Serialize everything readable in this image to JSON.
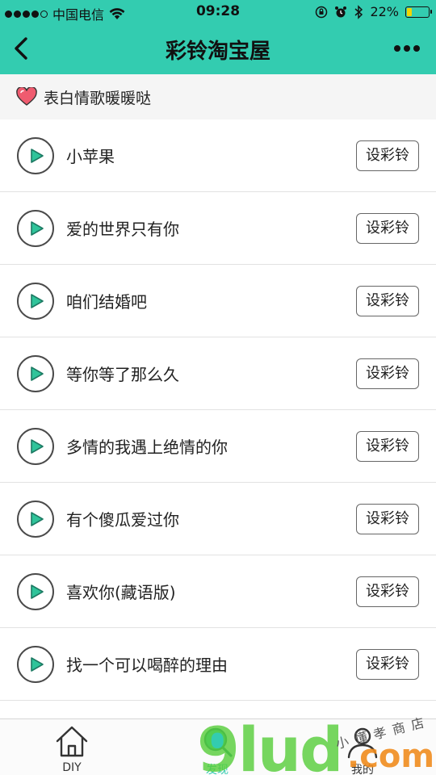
{
  "status_bar": {
    "carrier": "中国电信",
    "time": "09:28",
    "battery": "22%",
    "battery_level": 0.22
  },
  "header": {
    "title": "彩铃淘宝屋",
    "back_icon": "chevron-left-icon",
    "more_icon": "more-dots-icon"
  },
  "category": {
    "label": "表白情歌暖暖哒",
    "icon": "heart-icon",
    "icon_color": "#ef5b6f"
  },
  "set_button_label": "设彩铃",
  "songs": [
    {
      "title": "小苹果"
    },
    {
      "title": "爱的世界只有你"
    },
    {
      "title": "咱们结婚吧"
    },
    {
      "title": "等你等了那么久"
    },
    {
      "title": "多情的我遇上绝情的你"
    },
    {
      "title": "有个傻瓜爱过你"
    },
    {
      "title": "喜欢你(藏语版)"
    },
    {
      "title": "找一个可以喝醉的理由"
    },
    {
      "title": ""
    }
  ],
  "tabbar": {
    "items": [
      {
        "label": "DIY",
        "icon": "home-icon"
      },
      {
        "label": "发现",
        "icon": "discover-icon",
        "active": true
      },
      {
        "label": "我的",
        "icon": "user-icon"
      }
    ]
  },
  "watermark": {
    "brand": "9lud",
    "domain": ".com",
    "tagline": "小懂孝商店"
  },
  "colors": {
    "accent": "#33ccb0",
    "play_triangle": "#2fc49a"
  }
}
